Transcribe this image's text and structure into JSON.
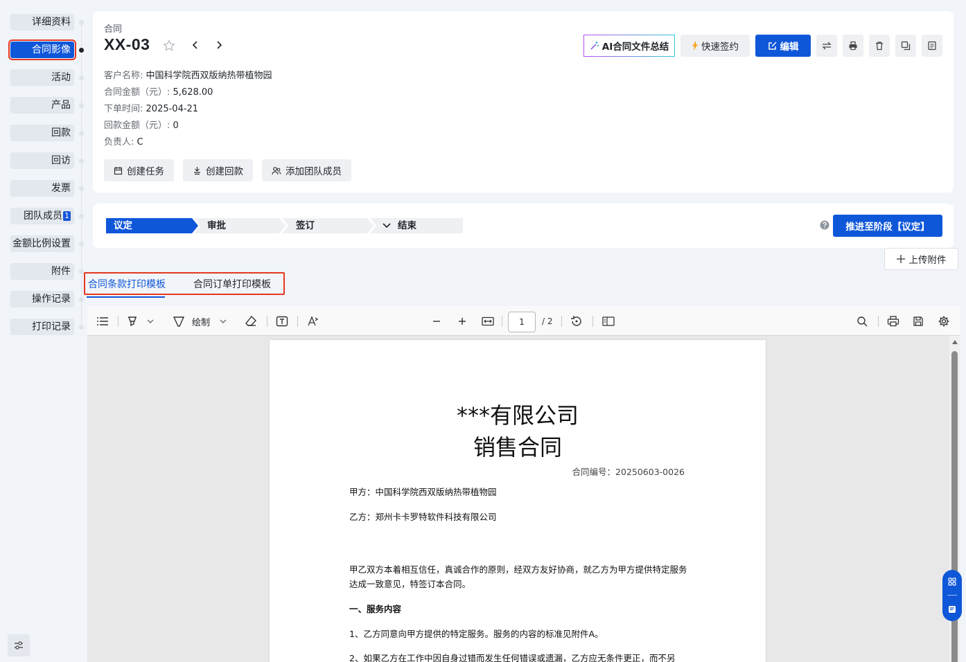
{
  "sidebar": {
    "items": [
      {
        "label": "详细资料"
      },
      {
        "label": "合同影像",
        "active": true
      },
      {
        "label": "活动"
      },
      {
        "label": "产品"
      },
      {
        "label": "回款"
      },
      {
        "label": "回访"
      },
      {
        "label": "发票"
      },
      {
        "label": "团队成员",
        "badge": "1"
      },
      {
        "label": "金额比例设置"
      },
      {
        "label": "附件"
      },
      {
        "label": "操作记录"
      },
      {
        "label": "打印记录"
      }
    ]
  },
  "header": {
    "breadcrumb": "合同",
    "title": "XX-03",
    "toolbar": {
      "ai_summary": "AI合同文件总结",
      "quick_sign": "快速签约",
      "edit": "编辑"
    },
    "fields": [
      {
        "key": "客户名称:",
        "value": "中国科学院西双版纳热带植物园"
      },
      {
        "key": "合同金额（元）:",
        "value": "5,628.00"
      },
      {
        "key": "下单时间:",
        "value": "2025-04-21"
      },
      {
        "key": "回款金额（元）:",
        "value": "0"
      },
      {
        "key": "负责人:",
        "value": "C"
      }
    ],
    "actions": {
      "create_task": "创建任务",
      "create_payment": "创建回款",
      "add_member": "添加团队成员"
    }
  },
  "stages": {
    "items": [
      "议定",
      "审批",
      "签订",
      "结束"
    ],
    "current": "议定",
    "advance_button": "推进至阶段【议定】"
  },
  "upload": {
    "label": "上传附件"
  },
  "templates": {
    "tabs": [
      "合同条款打印模板",
      "合同订单打印模板"
    ],
    "active_index": 0
  },
  "viewer": {
    "draw_label": "绘制",
    "current_page": "1",
    "total_pages": "/ 2",
    "document": {
      "heading1": "***有限公司",
      "heading2": "销售合同",
      "contract_no": "合同编号：20250603-0026",
      "party_a": "甲方：中国科学院西双版纳热带植物园",
      "party_b": "乙方：郑州卡卡罗特软件科技有限公司",
      "intro": "甲乙双方本着相互信任，真诚合作的原则，经双方友好协商，就乙方为甲方提供特定服务达成一致意见，特签订本合同。",
      "section1_title": "一、服务内容",
      "clause1": "1、乙方同意向甲方提供的特定服务。服务的内容的标准见附件A。",
      "clause2": "2、如果乙方在工作中因自身过错而发生任何错误或遗漏，乙方应无条件更正，而不另"
    }
  },
  "colors": {
    "primary": "#0f57d9",
    "highlight_border": "#e5371f",
    "background": "#f1f4f8"
  }
}
